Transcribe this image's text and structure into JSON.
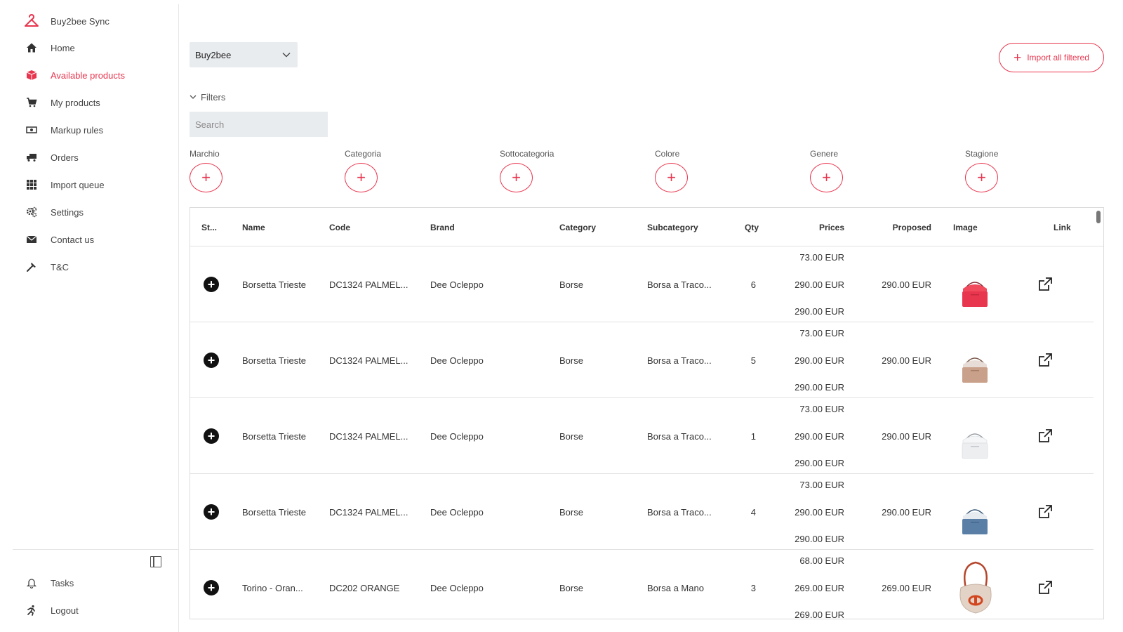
{
  "sidebar": {
    "brand": {
      "label": "Buy2bee Sync",
      "icon": "hanger-logo-icon"
    },
    "items": [
      {
        "label": "Home",
        "icon": "home-icon"
      },
      {
        "label": "Available products",
        "icon": "box-icon",
        "active": true
      },
      {
        "label": "My products",
        "icon": "cart-icon"
      },
      {
        "label": "Markup rules",
        "icon": "cash-icon"
      },
      {
        "label": "Orders",
        "icon": "truck-icon"
      },
      {
        "label": "Import queue",
        "icon": "grid-icon"
      },
      {
        "label": "Settings",
        "icon": "gears-icon"
      },
      {
        "label": "Contact us",
        "icon": "envelope-icon"
      },
      {
        "label": "T&C",
        "icon": "hammer-icon"
      }
    ],
    "bottom": [
      {
        "label": "Tasks",
        "icon": "bell-icon"
      },
      {
        "label": "Logout",
        "icon": "running-person-icon"
      }
    ]
  },
  "toolbar": {
    "shop_select": "Buy2bee",
    "import_label": "Import all filtered"
  },
  "filters": {
    "toggle_label": "Filters",
    "search_placeholder": "Search",
    "facets": [
      "Marchio",
      "Categoria",
      "Sottocategoria",
      "Colore",
      "Genere",
      "Stagione"
    ],
    "add_symbol": "+"
  },
  "table": {
    "columns": [
      "St...",
      "Name",
      "Code",
      "Brand",
      "Category",
      "Subcategory",
      "Qty",
      "Prices",
      "Proposed",
      "Image",
      "Link"
    ],
    "rows": [
      {
        "name": "Borsetta Trieste",
        "code": "DC1324 PALMEL...",
        "brand": "Dee Ocleppo",
        "category": "Borse",
        "subcategory": "Borsa a Traco...",
        "qty": "6",
        "prices": [
          "73.00 EUR",
          "290.00 EUR",
          "290.00 EUR"
        ],
        "proposed": "290.00 EUR",
        "image": "red-handbag"
      },
      {
        "name": "Borsetta Trieste",
        "code": "DC1324 PALMEL...",
        "brand": "Dee Ocleppo",
        "category": "Borse",
        "subcategory": "Borsa a Traco...",
        "qty": "5",
        "prices": [
          "73.00 EUR",
          "290.00 EUR",
          "290.00 EUR"
        ],
        "proposed": "290.00 EUR",
        "image": "beige-handbag"
      },
      {
        "name": "Borsetta Trieste",
        "code": "DC1324 PALMEL...",
        "brand": "Dee Ocleppo",
        "category": "Borse",
        "subcategory": "Borsa a Traco...",
        "qty": "1",
        "prices": [
          "73.00 EUR",
          "290.00 EUR",
          "290.00 EUR"
        ],
        "proposed": "290.00 EUR",
        "image": "white-handbag"
      },
      {
        "name": "Borsetta Trieste",
        "code": "DC1324 PALMEL...",
        "brand": "Dee Ocleppo",
        "category": "Borse",
        "subcategory": "Borsa a Traco...",
        "qty": "4",
        "prices": [
          "73.00 EUR",
          "290.00 EUR",
          "290.00 EUR"
        ],
        "proposed": "290.00 EUR",
        "image": "blue-handbag"
      },
      {
        "name": "Torino - Oran...",
        "code": "DC202 ORANGE",
        "brand": "Dee Ocleppo",
        "category": "Borse",
        "subcategory": "Borsa a Mano",
        "qty": "3",
        "prices": [
          "68.00 EUR",
          "269.00 EUR",
          "269.00 EUR"
        ],
        "proposed": "269.00 EUR",
        "image": "orange-hobo-bag"
      }
    ]
  },
  "colors": {
    "accent": "#e8364f",
    "red_bag": "#e8364f",
    "beige_bag": "#c9a08a",
    "white_bag": "#eceef0",
    "blue_bag": "#5a7fa6"
  }
}
